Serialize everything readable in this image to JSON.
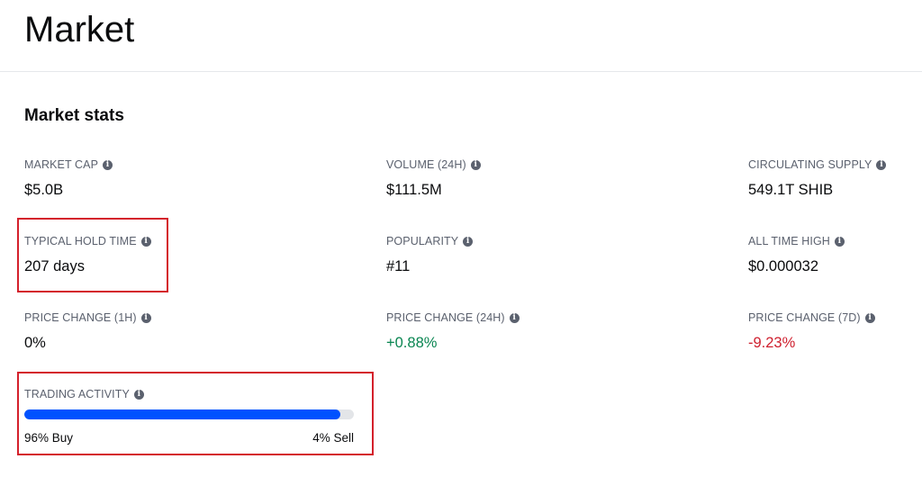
{
  "page": {
    "title": "Market"
  },
  "section": {
    "title": "Market stats"
  },
  "stats": {
    "market_cap": {
      "label": "MARKET CAP",
      "value": "$5.0B"
    },
    "volume_24h": {
      "label": "VOLUME (24H)",
      "value": "$111.5M"
    },
    "circulating_supply": {
      "label": "CIRCULATING SUPPLY",
      "value": "549.1T SHIB"
    },
    "typical_hold_time": {
      "label": "TYPICAL HOLD TIME",
      "value": "207 days"
    },
    "popularity": {
      "label": "POPULARITY",
      "value": "#11"
    },
    "all_time_high": {
      "label": "ALL TIME HIGH",
      "value": "$0.000032"
    },
    "price_change_1h": {
      "label": "PRICE CHANGE (1H)",
      "value": "0%"
    },
    "price_change_24h": {
      "label": "PRICE CHANGE (24H)",
      "value": "+0.88%"
    },
    "price_change_7d": {
      "label": "PRICE CHANGE (7D)",
      "value": "-9.23%"
    }
  },
  "trading_activity": {
    "label": "TRADING ACTIVITY",
    "buy_percent": 96,
    "buy_text": "96% Buy",
    "sell_text": "4% Sell"
  },
  "icons": {
    "info": "info-icon"
  },
  "colors": {
    "positive": "#098551",
    "negative": "#cf202f",
    "bar_fill": "#0052ff",
    "bar_track": "#e3e5e8",
    "highlight": "#d4202b"
  }
}
